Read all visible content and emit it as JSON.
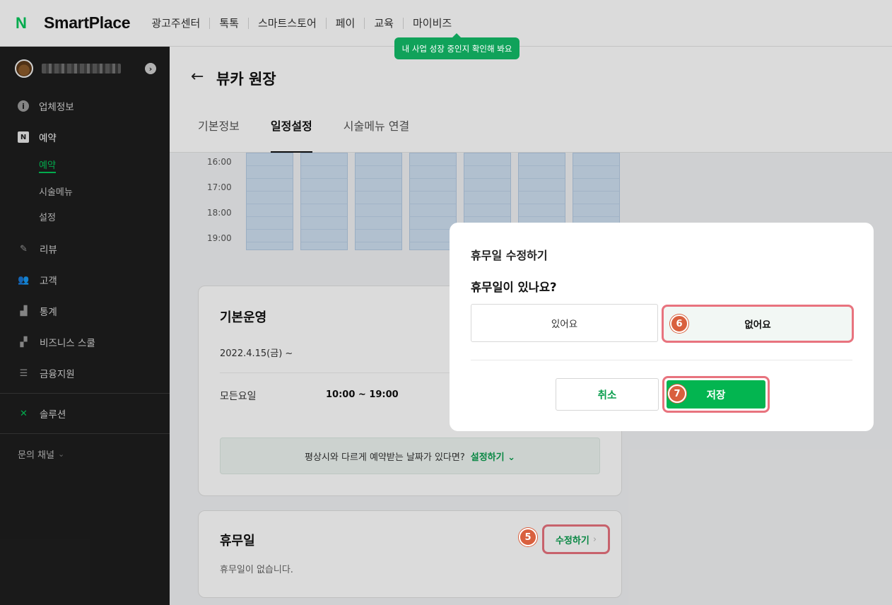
{
  "header": {
    "logo_n": "N",
    "logo_text": "SmartPlace",
    "nav": [
      "광고주센터",
      "톡톡",
      "스마트스토어",
      "페이",
      "교육",
      "마이비즈"
    ],
    "tooltip": "내 사업 성장 중인지 확인해 봐요"
  },
  "sidebar": {
    "menu": [
      {
        "label": "업체정보",
        "icon": "info-icon"
      },
      {
        "label": "예약",
        "icon": "naver-n-icon"
      }
    ],
    "submenu": [
      "예약",
      "시술메뉴",
      "설정"
    ],
    "menu2": [
      {
        "label": "리뷰",
        "icon": "pencil-icon"
      },
      {
        "label": "고객",
        "icon": "people-icon"
      },
      {
        "label": "통계",
        "icon": "chart-icon"
      },
      {
        "label": "비즈니스 스쿨",
        "icon": "stairs-icon"
      },
      {
        "label": "금융지원",
        "icon": "coins-icon"
      }
    ],
    "solution": "솔루션",
    "channel": "문의 채널"
  },
  "page": {
    "back": "←",
    "title": "뷰카 원장",
    "tabs": [
      "기본정보",
      "일정설정",
      "시술메뉴 연결"
    ],
    "active_tab": "일정설정"
  },
  "schedule": {
    "times": [
      "16:00",
      "17:00",
      "18:00",
      "19:00"
    ]
  },
  "basic_operation": {
    "title": "기본운영",
    "date": "2022.4.15(금) ~",
    "day_label": "모든요일",
    "hours": "10:00 ~ 19:00",
    "special_text": "평상시와 다르게 예약받는 날짜가 있다면?",
    "special_link": "설정하기",
    "special_chevron": "⌄"
  },
  "holiday": {
    "title": "휴무일",
    "status": "휴무일이 없습니다.",
    "edit_label": "수정하기",
    "edit_chevron": "›"
  },
  "modal": {
    "title": "휴무일 수정하기",
    "question": "휴무일이 있나요?",
    "option_yes": "있어요",
    "option_no": "없어요",
    "cancel": "취소",
    "save": "저장"
  },
  "steps": {
    "edit": "5",
    "no_option": "6",
    "save": "7"
  },
  "colors": {
    "brand_green": "#03c75a",
    "highlight": "#e8737e",
    "step_badge": "#d9603e"
  }
}
